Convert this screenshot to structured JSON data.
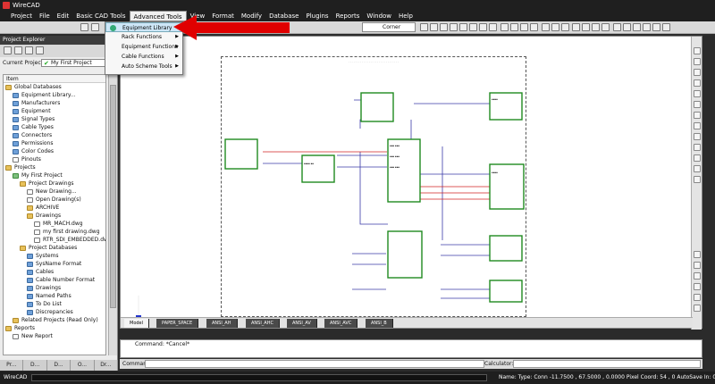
{
  "window": {
    "title": "WireCAD"
  },
  "menu": [
    "Project",
    "File",
    "Edit",
    "Basic CAD Tools",
    "Advanced Tools",
    "View",
    "Format",
    "Modify",
    "Database",
    "Plugins",
    "Reports",
    "Window",
    "Help"
  ],
  "toolbar": {
    "corner_label": "Corner"
  },
  "dropdown": {
    "items": [
      {
        "label": "Equipment Library",
        "highlighted": true,
        "submenu": false
      },
      {
        "label": "Rack Functions",
        "submenu": true
      },
      {
        "label": "Equipment Functions",
        "submenu": true
      },
      {
        "label": "Cable Functions",
        "submenu": true
      },
      {
        "label": "Auto Scheme Tools",
        "submenu": true
      }
    ]
  },
  "explorer": {
    "title": "Project Explorer",
    "current_project_label": "Current Project:",
    "current_project_value": "My First Project",
    "column_header": "Item",
    "tree": [
      {
        "label": "Global Databases",
        "depth": 0,
        "icon": "folder"
      },
      {
        "label": "Equipment Library...",
        "depth": 1,
        "icon": "db"
      },
      {
        "label": "Manufacturers",
        "depth": 1,
        "icon": "db"
      },
      {
        "label": "Equipment",
        "depth": 1,
        "icon": "db"
      },
      {
        "label": "Signal Types",
        "depth": 1,
        "icon": "db"
      },
      {
        "label": "Cable Types",
        "depth": 1,
        "icon": "db"
      },
      {
        "label": "Connectors",
        "depth": 1,
        "icon": "db"
      },
      {
        "label": "Permissions",
        "depth": 1,
        "icon": "db"
      },
      {
        "label": "Color Codes",
        "depth": 1,
        "icon": "db"
      },
      {
        "label": "Pinouts",
        "depth": 1,
        "icon": "page"
      },
      {
        "label": "Projects",
        "depth": 0,
        "icon": "folder"
      },
      {
        "label": "My First Project",
        "depth": 1,
        "icon": "proj"
      },
      {
        "label": "Project Drawings",
        "depth": 2,
        "icon": "folder"
      },
      {
        "label": "New Drawing...",
        "depth": 3,
        "icon": "page"
      },
      {
        "label": "Open Drawing(s)",
        "depth": 3,
        "icon": "page"
      },
      {
        "label": "ARCHIVE",
        "depth": 3,
        "icon": "folder"
      },
      {
        "label": "Drawings",
        "depth": 3,
        "icon": "folder"
      },
      {
        "label": "MR_MACH.dwg",
        "depth": 4,
        "icon": "page"
      },
      {
        "label": "my first drawing.dwg",
        "depth": 4,
        "icon": "page"
      },
      {
        "label": "RTR_SDI_EMBEDDED.dw",
        "depth": 4,
        "icon": "page"
      },
      {
        "label": "Project Databases",
        "depth": 2,
        "icon": "folder"
      },
      {
        "label": "Systems",
        "depth": 3,
        "icon": "db"
      },
      {
        "label": "SysName Format",
        "depth": 3,
        "icon": "db"
      },
      {
        "label": "Cables",
        "depth": 3,
        "icon": "db"
      },
      {
        "label": "Cable Number Format",
        "depth": 3,
        "icon": "db"
      },
      {
        "label": "Drawings",
        "depth": 3,
        "icon": "db"
      },
      {
        "label": "Named Paths",
        "depth": 3,
        "icon": "db"
      },
      {
        "label": "To Do List",
        "depth": 3,
        "icon": "db"
      },
      {
        "label": "Discrepancies",
        "depth": 3,
        "icon": "db"
      },
      {
        "label": "Related Projects (Read Only)",
        "depth": 1,
        "icon": "folder"
      },
      {
        "label": "Reports",
        "depth": 0,
        "icon": "folder"
      },
      {
        "label": "New Report",
        "depth": 1,
        "icon": "page"
      }
    ],
    "bottom_tabs": [
      "Pr...",
      "D...",
      "D...",
      "O...",
      "Dr..."
    ]
  },
  "layout_tabs": [
    "Model",
    "PAPER_SPACE",
    "ANSI_AH",
    "ANSI_AHC",
    "ANSI_AV",
    "ANSI_AVC",
    "ANSI_B"
  ],
  "command": {
    "output": "Command: *Cancel*",
    "prompt_label": "Command:",
    "calculator_label": "Calculator:"
  },
  "status": {
    "app": "WireCAD",
    "right": "Name:   Type:  Conn     -11.7500 , 67.5000 , 0.0000   Pixel Coord: 54 , 0    AutoSave In: 05:20"
  },
  "colors": {
    "accent": "#cde6f7",
    "arrow": "#e00000",
    "box_stroke": "#1f8a1f",
    "wire": "#3a3aa8",
    "signal": "#d02020"
  }
}
